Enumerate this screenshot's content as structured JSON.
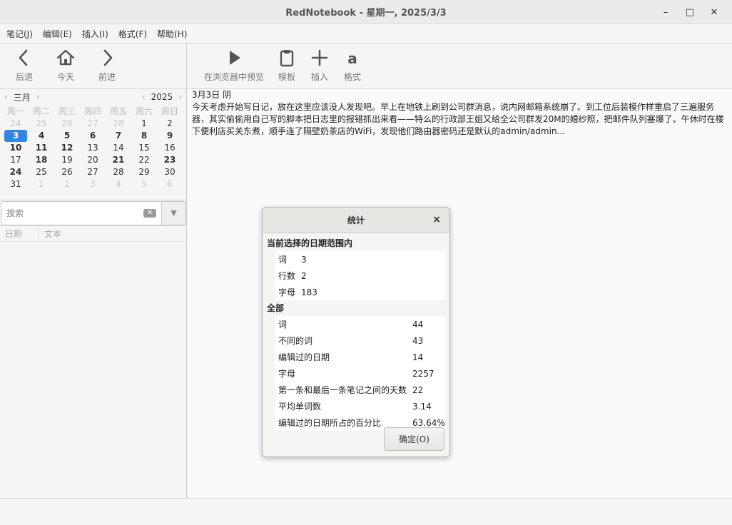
{
  "window": {
    "title": "RedNotebook - 星期一, 2025/3/3",
    "minimize": "–",
    "maximize": "□",
    "close": "✕"
  },
  "menu": [
    "笔记(J)",
    "编辑(E)",
    "插入(I)",
    "格式(F)",
    "帮助(H)"
  ],
  "nav_toolbar": {
    "back": "后退",
    "today": "今天",
    "forward": "前进"
  },
  "calendar": {
    "month": "三月",
    "year": "2025",
    "weekdays": [
      "周一",
      "周二",
      "周三",
      "周四",
      "周五",
      "周六",
      "周日"
    ],
    "days": [
      {
        "d": "24",
        "t": "other"
      },
      {
        "d": "25",
        "t": "other"
      },
      {
        "d": "26",
        "t": "other"
      },
      {
        "d": "27",
        "t": "other"
      },
      {
        "d": "28",
        "t": "other"
      },
      {
        "d": "1",
        "t": ""
      },
      {
        "d": "2",
        "t": ""
      },
      {
        "d": "3",
        "t": "sel"
      },
      {
        "d": "4",
        "t": "bold"
      },
      {
        "d": "5",
        "t": "bold"
      },
      {
        "d": "6",
        "t": "bold"
      },
      {
        "d": "7",
        "t": "bold"
      },
      {
        "d": "8",
        "t": "bold"
      },
      {
        "d": "9",
        "t": "bold"
      },
      {
        "d": "10",
        "t": "bold"
      },
      {
        "d": "11",
        "t": "bold"
      },
      {
        "d": "12",
        "t": "bold"
      },
      {
        "d": "13",
        "t": ""
      },
      {
        "d": "14",
        "t": ""
      },
      {
        "d": "15",
        "t": ""
      },
      {
        "d": "16",
        "t": ""
      },
      {
        "d": "17",
        "t": ""
      },
      {
        "d": "18",
        "t": "bold"
      },
      {
        "d": "19",
        "t": ""
      },
      {
        "d": "20",
        "t": ""
      },
      {
        "d": "21",
        "t": "bold"
      },
      {
        "d": "22",
        "t": ""
      },
      {
        "d": "23",
        "t": "bold"
      },
      {
        "d": "24",
        "t": "bold"
      },
      {
        "d": "25",
        "t": ""
      },
      {
        "d": "26",
        "t": ""
      },
      {
        "d": "27",
        "t": ""
      },
      {
        "d": "28",
        "t": ""
      },
      {
        "d": "29",
        "t": ""
      },
      {
        "d": "30",
        "t": ""
      },
      {
        "d": "31",
        "t": ""
      },
      {
        "d": "1",
        "t": "other"
      },
      {
        "d": "2",
        "t": "other"
      },
      {
        "d": "3",
        "t": "other"
      },
      {
        "d": "4",
        "t": "other"
      },
      {
        "d": "5",
        "t": "other"
      },
      {
        "d": "6",
        "t": "other"
      }
    ],
    "selected_color": "#3584e4"
  },
  "search": {
    "placeholder": "搜索"
  },
  "list": {
    "col_date": "日期",
    "col_text": "文本"
  },
  "edit_toolbar": {
    "preview": "在浏览器中预览",
    "template": "模板",
    "insert": "插入",
    "format": "格式"
  },
  "editor": {
    "date_line": "3月3日 阴",
    "body": "今天考虑开始写日记，放在这里应该没人发现吧。早上在地铁上刷到公司群消息，说内网邮箱系统崩了。到工位后装模作样重启了三遍服务器，其实偷偷用自己写的脚本把日志里的报错抓出来看——特么的行政部王姐又给全公司群发20M的婚纱照，把邮件队列塞爆了。午休时在楼下便利店买关东煮，顺手连了隔壁奶茶店的WiFi，发现他们路由器密码还是默认的admin/admin..."
  },
  "dialog": {
    "title": "统计",
    "close": "×",
    "section_selected": "当前选择的日期范围内",
    "selected_stats": [
      {
        "k": "词",
        "v": "3"
      },
      {
        "k": "行数",
        "v": "2"
      },
      {
        "k": "字母",
        "v": "183"
      }
    ],
    "section_all": "全部",
    "all_stats": [
      {
        "k": "词",
        "v": "44"
      },
      {
        "k": "不同的词",
        "v": "43"
      },
      {
        "k": "编辑过的日期",
        "v": "14"
      },
      {
        "k": "字母",
        "v": "2257"
      },
      {
        "k": "第一条和最后一条笔记之间的天数",
        "v": "22"
      },
      {
        "k": "平均单词数",
        "v": "3.14"
      },
      {
        "k": "编辑过的日期所占的百分比",
        "v": "63.64%"
      }
    ],
    "ok": "确定(O)"
  }
}
